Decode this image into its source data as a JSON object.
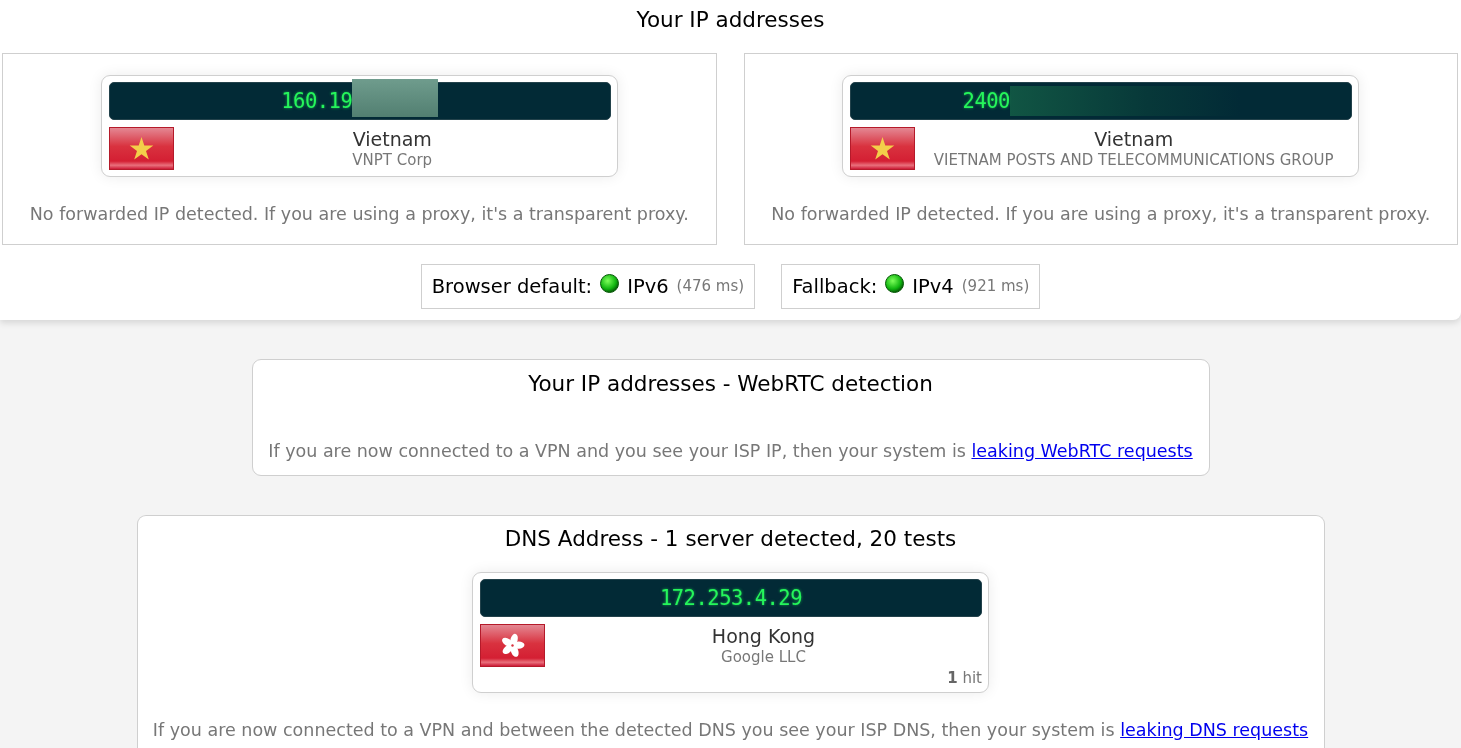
{
  "title": "Your IP addresses",
  "ip_panels": [
    {
      "ip": "160.19",
      "mask": {
        "kind": "box"
      },
      "flag": {
        "kind": "vn"
      },
      "country": "Vietnam",
      "isp": "VNPT Corp",
      "note": "No forwarded IP detected. If you are using a proxy, it's a transparent proxy."
    },
    {
      "ip": "2400",
      "mask": {
        "kind": "fade"
      },
      "flag": {
        "kind": "vn"
      },
      "country": "Vietnam",
      "isp": "VIETNAM POSTS AND TELECOMMUNICATIONS GROUP",
      "note": "No forwarded IP detected. If you are using a proxy, it's a transparent proxy."
    }
  ],
  "protocols": [
    {
      "label": "Browser default:",
      "ok": true,
      "protocol": "IPv6",
      "time": "(476 ms)"
    },
    {
      "label": "Fallback:",
      "ok": true,
      "protocol": "IPv4",
      "time": "(921 ms)"
    }
  ],
  "webrtc": {
    "title": "Your IP addresses - WebRTC detection",
    "note": "If you are now connected to a VPN and you see your ISP IP, then your system is",
    "link": "leaking WebRTC requests"
  },
  "dns": {
    "title": "DNS Address - 1 server detected, 20 tests",
    "servers": [
      {
        "ip": "172.253.4.29",
        "flag": {
          "kind": "hk"
        },
        "country": "Hong Kong",
        "isp": "Google LLC",
        "hits": "**1** hit"
      }
    ],
    "note": "If you are now connected to a VPN and between the detected DNS you see your ISP DNS, then your system is",
    "link": "leaking DNS requests"
  }
}
